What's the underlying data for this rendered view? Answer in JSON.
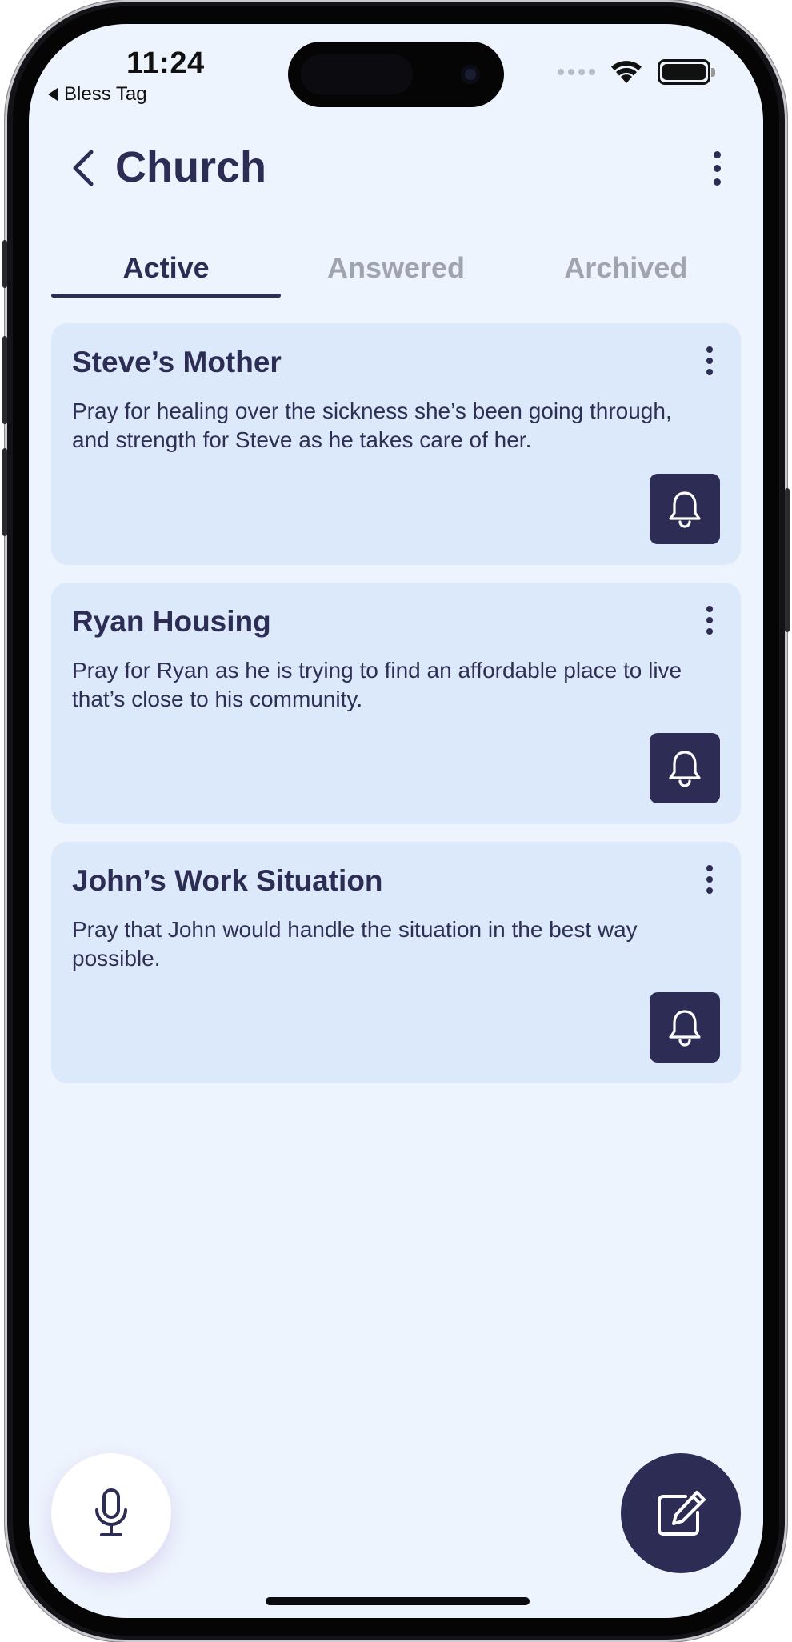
{
  "status_bar": {
    "time": "11:24",
    "back_app": "Bless Tag"
  },
  "header": {
    "title": "Church",
    "back_icon": "chevron-left-icon",
    "menu_icon": "more-vertical-icon"
  },
  "tabs": [
    {
      "label": "Active",
      "selected": true
    },
    {
      "label": "Answered",
      "selected": false
    },
    {
      "label": "Archived",
      "selected": false
    }
  ],
  "prayers": [
    {
      "title": "Steve’s Mother",
      "text": "Pray for healing over the sickness she’s been going through, and strength for Steve as he takes care of her."
    },
    {
      "title": "Ryan Housing",
      "text": "Pray for Ryan as he is trying to find an affordable place to live that’s close to his community."
    },
    {
      "title": "John’s Work Situation",
      "text": "Pray that John would handle the situation in the best way possible."
    }
  ],
  "actions": {
    "mic_icon": "microphone-icon",
    "compose_icon": "edit-note-icon",
    "reminder_icon": "bell-icon"
  },
  "colors": {
    "primary": "#2c2c54",
    "background": "#eef4fd",
    "card": "#dce9fb",
    "inactive_tab": "#a1a3ad"
  }
}
